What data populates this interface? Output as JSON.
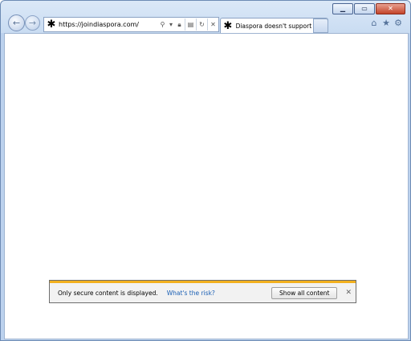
{
  "window": {
    "minimize_icon": "minimize-icon",
    "maximize_icon": "maximize-icon",
    "close_icon": "close-icon"
  },
  "navigation": {
    "back_icon": "back-arrow-icon",
    "forward_icon": "forward-arrow-icon"
  },
  "address_bar": {
    "url": "https://joindiaspora.com/",
    "favicon": "asterisk-favicon-icon",
    "icons": [
      "search-icon",
      "dropdown-icon",
      "lock-icon",
      "compatibility-icon",
      "refresh-icon",
      "stop-icon"
    ]
  },
  "tab": {
    "title": "Diaspora doesn't support you...",
    "favicon": "asterisk-favicon-icon"
  },
  "toolbar": {
    "icons": [
      "home-icon",
      "favorites-icon",
      "settings-gear-icon"
    ]
  },
  "notification": {
    "message": "Only secure content is displayed.",
    "link": "What's the risk?",
    "button": "Show all content",
    "close_icon": "close-icon",
    "accent_color": "#f2b01e"
  }
}
